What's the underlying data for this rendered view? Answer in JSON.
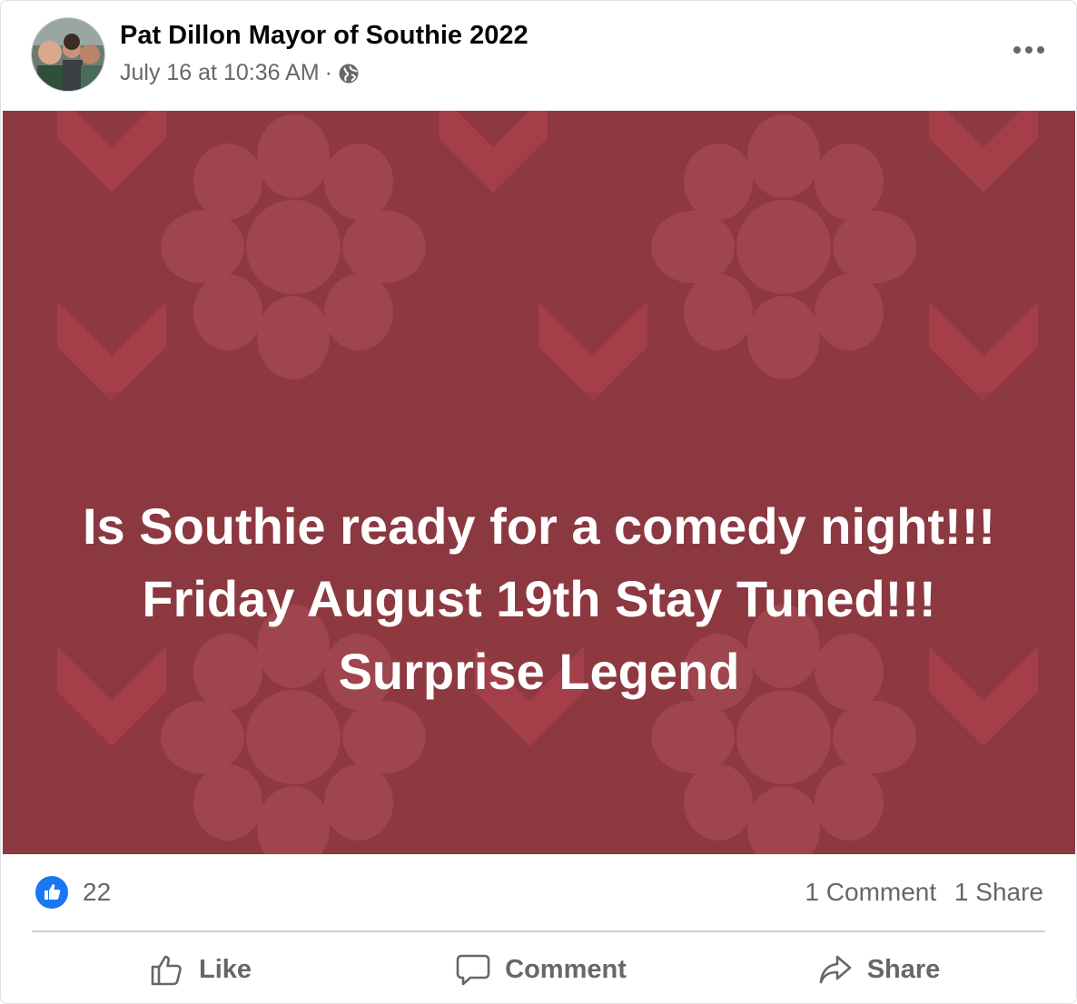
{
  "post": {
    "author": "Pat Dillon Mayor of Southie 2022",
    "timestamp": "July 16 at 10:36 AM",
    "separator": "·",
    "privacy_icon": "globe-icon",
    "more_icon": "more-horizontal-icon"
  },
  "media": {
    "background_color": "#8e3840",
    "lines": [
      "Is Southie ready for a comedy night!!!",
      "Friday August 19th Stay Tuned!!!",
      "Surprise Legend"
    ]
  },
  "stats": {
    "reaction_icon": "like-reaction-icon",
    "like_count": "22",
    "comments": "1 Comment",
    "shares": "1 Share"
  },
  "actions": {
    "like": "Like",
    "comment": "Comment",
    "share": "Share"
  },
  "colors": {
    "accent": "#1877f2",
    "secondary_text": "#65676b"
  }
}
